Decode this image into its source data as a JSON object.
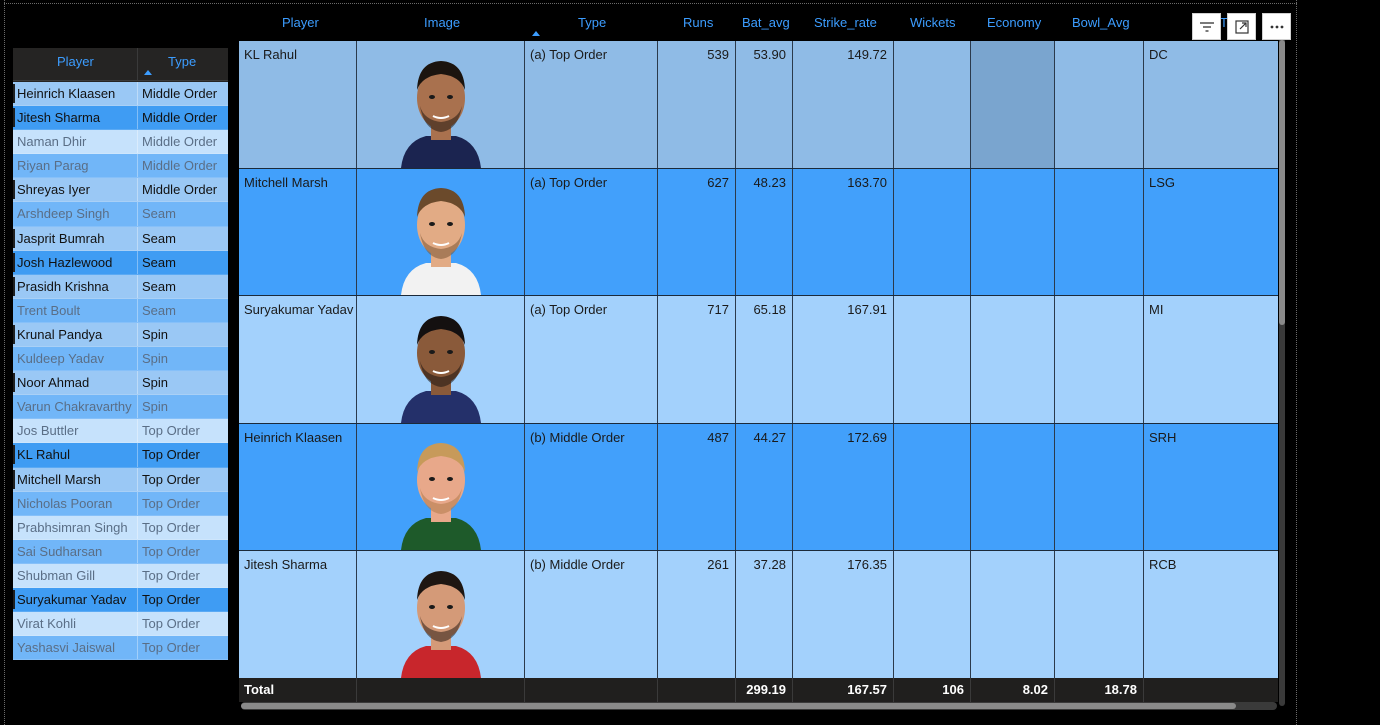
{
  "slicer": {
    "columns": [
      "Player",
      "Type"
    ],
    "rows": [
      {
        "player": "Heinrich Klaasen",
        "type": "Middle Order",
        "state": "sel",
        "bg": "#9ac8f5"
      },
      {
        "player": "Jitesh Sharma",
        "type": "Middle Order",
        "state": "sel",
        "bg": "#3f9cf3"
      },
      {
        "player": "Naman Dhir",
        "type": "Middle Order",
        "state": "dim",
        "bg": "#c6e2fc"
      },
      {
        "player": "Riyan Parag",
        "type": "Middle Order",
        "state": "dim",
        "bg": "#71b6f8"
      },
      {
        "player": "Shreyas Iyer",
        "type": "Middle Order",
        "state": "sel",
        "bg": "#9ac8f5"
      },
      {
        "player": "Arshdeep Singh",
        "type": "Seam",
        "state": "dim",
        "bg": "#71b6f8"
      },
      {
        "player": "Jasprit Bumrah",
        "type": "Seam",
        "state": "sel",
        "bg": "#9ac8f5"
      },
      {
        "player": "Josh Hazlewood",
        "type": "Seam",
        "state": "sel",
        "bg": "#3f9cf3"
      },
      {
        "player": "Prasidh Krishna",
        "type": "Seam",
        "state": "sel",
        "bg": "#9ac8f5"
      },
      {
        "player": "Trent Boult",
        "type": "Seam",
        "state": "dim",
        "bg": "#71b6f8"
      },
      {
        "player": "Krunal Pandya",
        "type": "Spin",
        "state": "sel",
        "bg": "#9ac8f5"
      },
      {
        "player": "Kuldeep Yadav",
        "type": "Spin",
        "state": "dim",
        "bg": "#71b6f8"
      },
      {
        "player": "Noor Ahmad",
        "type": "Spin",
        "state": "sel",
        "bg": "#9ac8f5"
      },
      {
        "player": "Varun Chakravarthy",
        "type": "Spin",
        "state": "dim",
        "bg": "#71b6f8"
      },
      {
        "player": "Jos Buttler",
        "type": "Top Order",
        "state": "dim",
        "bg": "#c6e2fc"
      },
      {
        "player": "KL Rahul",
        "type": "Top Order",
        "state": "sel",
        "bg": "#3f9cf3"
      },
      {
        "player": "Mitchell Marsh",
        "type": "Top Order",
        "state": "sel",
        "bg": "#9ac8f5"
      },
      {
        "player": "Nicholas Pooran",
        "type": "Top Order",
        "state": "dim",
        "bg": "#71b6f8"
      },
      {
        "player": "Prabhsimran Singh",
        "type": "Top Order",
        "state": "dim",
        "bg": "#c6e2fc"
      },
      {
        "player": "Sai Sudharsan",
        "type": "Top Order",
        "state": "dim",
        "bg": "#71b6f8"
      },
      {
        "player": "Shubman Gill",
        "type": "Top Order",
        "state": "dim",
        "bg": "#c6e2fc"
      },
      {
        "player": "Suryakumar Yadav",
        "type": "Top Order",
        "state": "sel",
        "bg": "#3f9cf3"
      },
      {
        "player": "Virat Kohli",
        "type": "Top Order",
        "state": "dim",
        "bg": "#c6e2fc"
      },
      {
        "player": "Yashasvi Jaiswal",
        "type": "Top Order",
        "state": "dim",
        "bg": "#71b6f8"
      }
    ]
  },
  "table": {
    "columns": [
      "Player",
      "Image",
      "Type",
      "Runs",
      "Bat_avg",
      "Strike_rate",
      "Wickets",
      "Economy",
      "Bowl_Avg",
      "Team"
    ],
    "rows": [
      {
        "player": "KL Rahul",
        "type": "(a) Top Order",
        "runs": "539",
        "bat_avg": "53.90",
        "strike_rate": "149.72",
        "wickets": "",
        "economy": "",
        "bowl_avg": "",
        "team": "DC",
        "bg": "#8fbbe6",
        "skin": "#a9714e",
        "hair": "#1b140f",
        "beard": "#231811",
        "shirt": "#1b2450"
      },
      {
        "player": "Mitchell Marsh",
        "type": "(a) Top Order",
        "runs": "627",
        "bat_avg": "48.23",
        "strike_rate": "163.70",
        "wickets": "",
        "economy": "",
        "bowl_avg": "",
        "team": "LSG",
        "bg": "#42a0fb",
        "skin": "#e2ab85",
        "hair": "#6b4a2b",
        "beard": "#7a5634",
        "shirt": "#f2f2f2"
      },
      {
        "player": "Suryakumar Yadav",
        "type": "(a) Top Order",
        "runs": "717",
        "bat_avg": "65.18",
        "strike_rate": "167.91",
        "wickets": "",
        "economy": "",
        "bowl_avg": "",
        "team": "MI",
        "bg": "#a3d1fc",
        "skin": "#8a5a3a",
        "hair": "#141010",
        "beard": "#1c1410",
        "shirt": "#24306a"
      },
      {
        "player": "Heinrich Klaasen",
        "type": "(b) Middle Order",
        "runs": "487",
        "bat_avg": "44.27",
        "strike_rate": "172.69",
        "wickets": "",
        "economy": "",
        "bowl_avg": "",
        "team": "SRH",
        "bg": "#42a0fb",
        "skin": "#e8a88a",
        "hair": "#c79a5a",
        "beard": "#b07a4a",
        "shirt": "#1e5a2a"
      },
      {
        "player": "Jitesh Sharma",
        "type": "(b) Middle Order",
        "runs": "261",
        "bat_avg": "37.28",
        "strike_rate": "176.35",
        "wickets": "",
        "economy": "",
        "bowl_avg": "",
        "team": "RCB",
        "bg": "#a3d1fc",
        "skin": "#d49a78",
        "hair": "#1e1612",
        "beard": "#2a1d16",
        "shirt": "#c8262c"
      }
    ],
    "total": {
      "label": "Total",
      "runs": "",
      "bat_avg": "299.19",
      "strike_rate": "167.57",
      "wickets": "106",
      "economy": "8.02",
      "bowl_avg": "18.78"
    }
  },
  "toolbar": {
    "icons": [
      "filter-icon",
      "focus-mode-icon",
      "more-options-icon"
    ]
  }
}
